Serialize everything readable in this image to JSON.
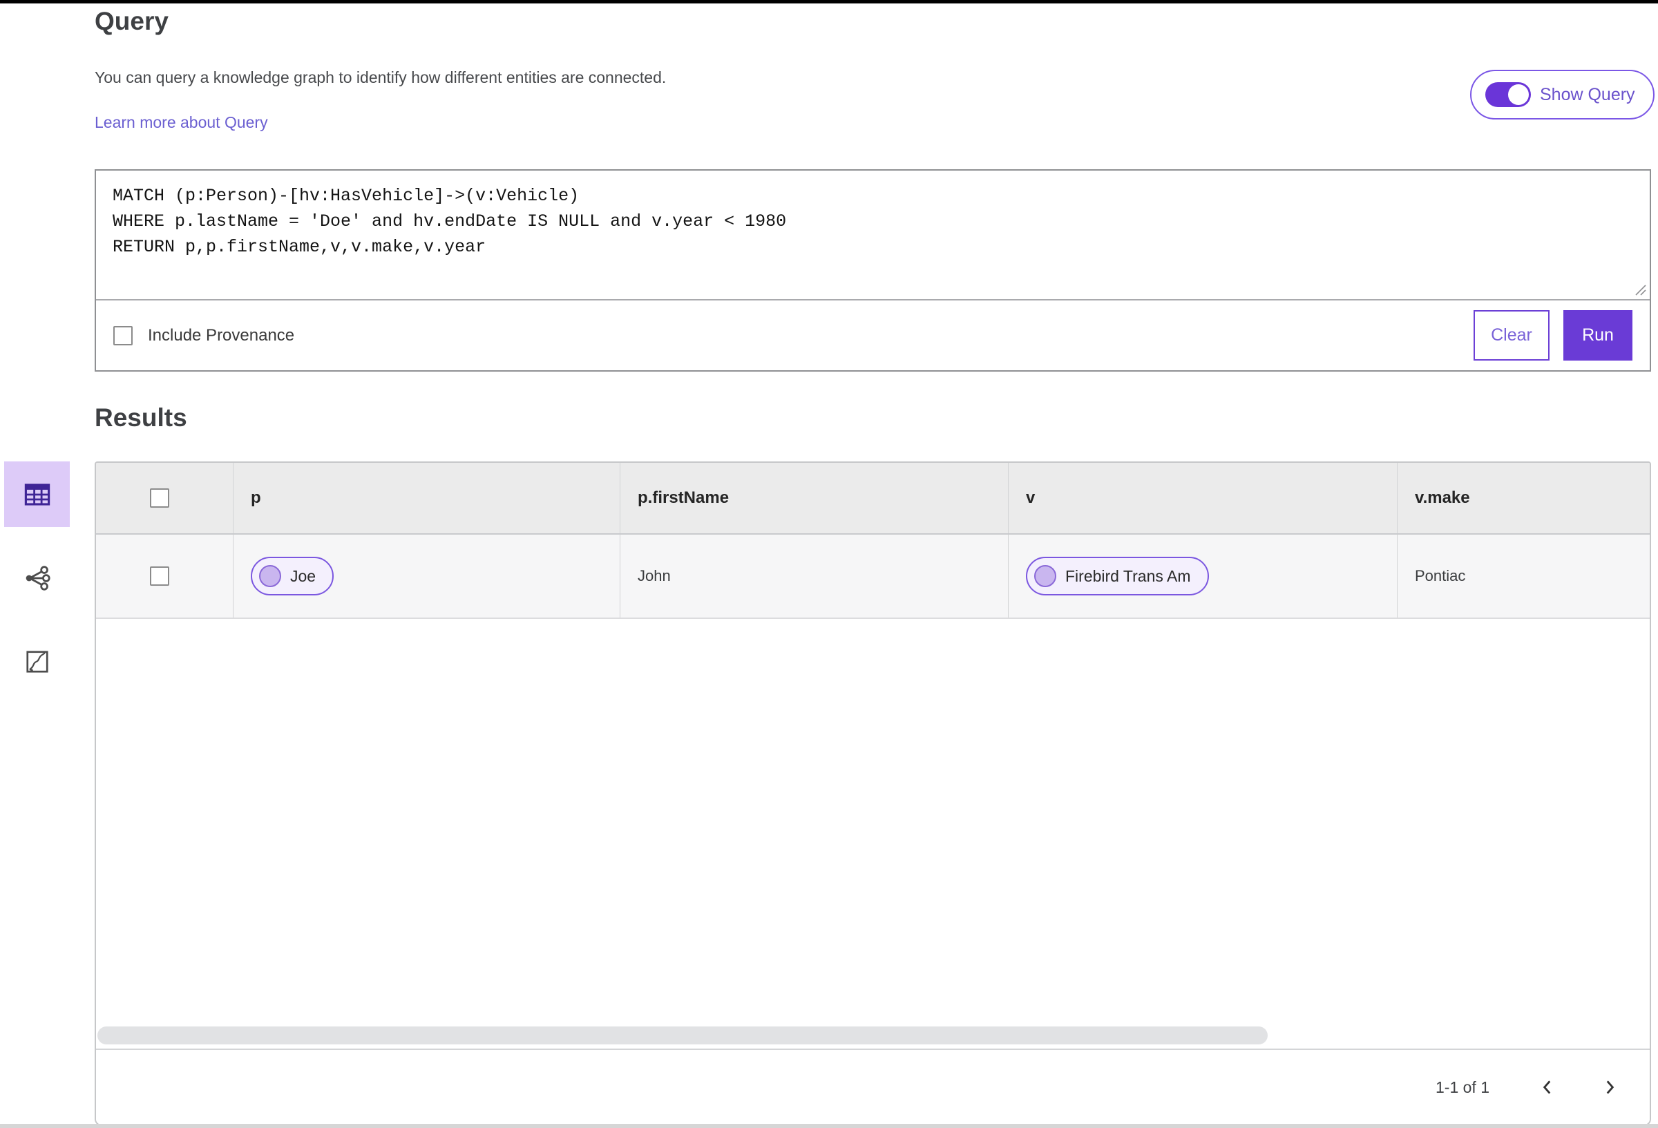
{
  "header": {
    "title": "Query",
    "description": "You can query a knowledge graph to identify how different entities are connected.",
    "learn_more_link": "Learn more about Query",
    "show_query": {
      "label": "Show Query",
      "state": "on"
    }
  },
  "query_panel": {
    "query_text": "MATCH (p:Person)-[hv:HasVehicle]->(v:Vehicle)\nWHERE p.lastName = 'Doe' and hv.endDate IS NULL and v.year < 1980\nRETURN p,p.firstName,v,v.make,v.year",
    "include_provenance": {
      "label": "Include Provenance",
      "checked": false
    },
    "clear_button": "Clear",
    "run_button": "Run"
  },
  "results": {
    "title": "Results",
    "view_modes": [
      {
        "name": "table-view",
        "icon": "table-icon",
        "selected": true
      },
      {
        "name": "network-view",
        "icon": "network-icon",
        "selected": false
      },
      {
        "name": "map-view",
        "icon": "map-icon",
        "selected": false
      }
    ],
    "table": {
      "columns": [
        "p",
        "p.firstName",
        "v",
        "v.make"
      ],
      "row": {
        "p_chip": "Joe",
        "p_firstName": "John",
        "v_chip": "Firebird Trans Am",
        "v_make": "Pontiac"
      }
    },
    "pagination": {
      "range_label": "1-1 of 1"
    }
  },
  "colors": {
    "accent_purple": "#6a3bd6",
    "chip_border": "#7b57e0",
    "chip_bg": "#f4f0fd",
    "chip_circle": "#c9b6ef",
    "link_purple": "#6b5fd1",
    "selected_view_bg": "#ddcbf8",
    "table_header_bg": "#ebebeb",
    "table_row_bg": "#f6f6f7"
  }
}
